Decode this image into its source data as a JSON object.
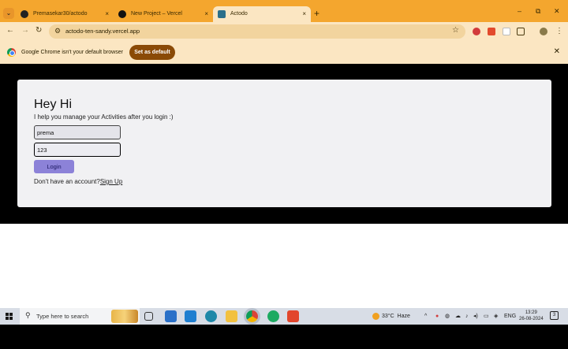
{
  "browser": {
    "tabs": [
      {
        "title": "Premasekar30/actodo",
        "active": false,
        "favicon": "github-icon"
      },
      {
        "title": "New Project – Vercel",
        "active": false,
        "favicon": "vercel-icon"
      },
      {
        "title": "Actodo",
        "active": true,
        "favicon": "actodo-icon"
      }
    ],
    "tab_close_glyph": "×",
    "new_tab_glyph": "+",
    "window_controls": {
      "minimize": "–",
      "maximize": "⧉",
      "close": "✕"
    },
    "url": "actodo-ten-sandy.vercel.app",
    "nav": {
      "back": "←",
      "forward": "→",
      "reload": "↻"
    },
    "infobar": {
      "message": "Google Chrome isn't your default browser",
      "button": "Set as default",
      "close": "✕"
    }
  },
  "page": {
    "heading": "Hey Hi",
    "subtitle": "I help you manage your Activities after you login :)",
    "username_value": "prema",
    "password_value": "123",
    "login_button": "Login",
    "signup_prompt": "Don't have an account?",
    "signup_link": "Sign Up"
  },
  "taskbar": {
    "search_placeholder": "Type here to search",
    "weather_temp": "33°C",
    "weather_desc": "Haze",
    "language": "ENG",
    "time": "13:29",
    "date": "26-08-2024",
    "notifications": "3"
  },
  "colors": {
    "tabstrip": "#f4a62e",
    "toolbar": "#fbe6c2",
    "card": "#f1f1f3",
    "login_button": "#8c82d8",
    "set_default_button": "#8a4a06"
  }
}
